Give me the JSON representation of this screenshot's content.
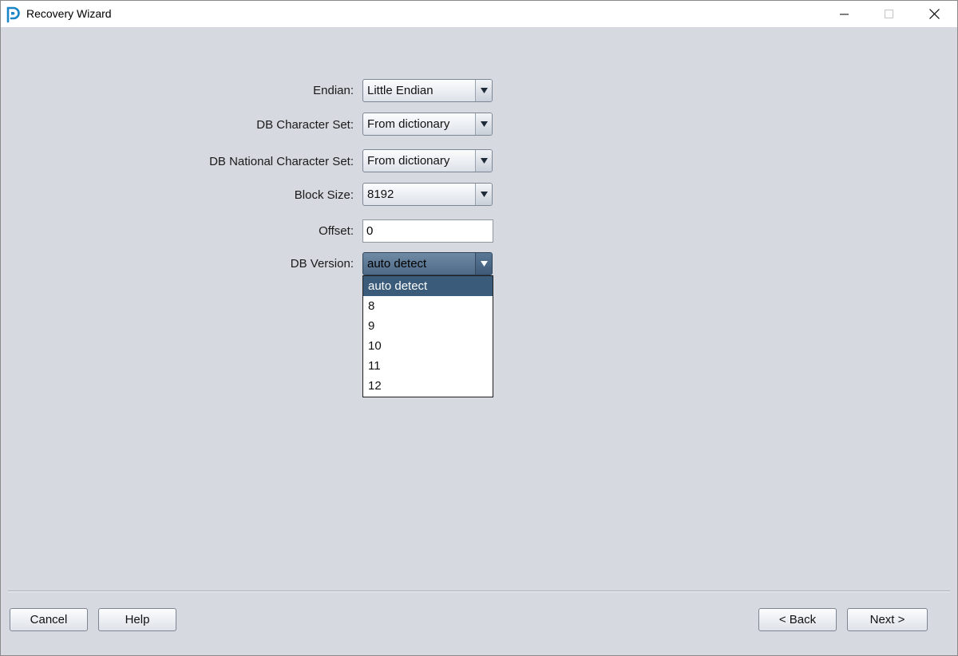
{
  "window": {
    "title": "Recovery Wizard"
  },
  "form": {
    "endian": {
      "label": "Endian:",
      "value": "Little Endian"
    },
    "db_charset": {
      "label": "DB Character Set:",
      "value": "From dictionary"
    },
    "db_national_charset": {
      "label": "DB National Character Set:",
      "value": "From dictionary"
    },
    "block_size": {
      "label": "Block Size:",
      "value": "8192"
    },
    "offset": {
      "label": "Offset:",
      "value": "0"
    },
    "db_version": {
      "label": "DB Version:",
      "value": "auto detect",
      "options": [
        "auto detect",
        "8",
        "9",
        "10",
        "11",
        "12"
      ],
      "selected_index": 0
    }
  },
  "footer": {
    "cancel": "Cancel",
    "help": "Help",
    "back": "< Back",
    "next": "Next >"
  },
  "colors": {
    "background": "#d6d9df",
    "selection": "#3b5b7a",
    "app_icon": "#1a86c8"
  },
  "icons": [
    "app-logo-icon",
    "minimize-icon",
    "maximize-icon",
    "close-icon",
    "dropdown-arrow-icon"
  ]
}
